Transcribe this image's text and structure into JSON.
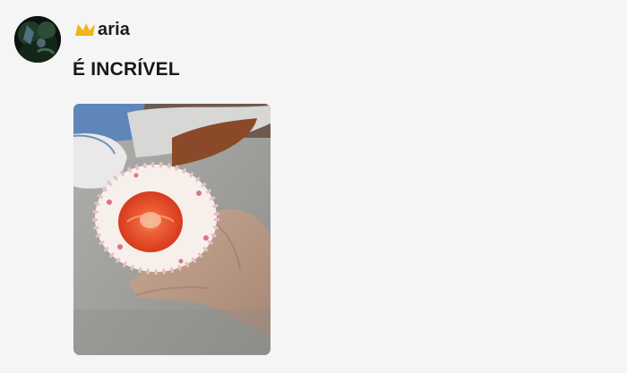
{
  "post": {
    "author": {
      "name": "aria",
      "badge_icon": "crown-icon",
      "badge_color": "#f2b418"
    },
    "text": "É INCRÍVEL",
    "image": {
      "subject": "strawberry-dessert-photo"
    }
  },
  "colors": {
    "background": "#f5f5f5",
    "text": "#171717"
  }
}
